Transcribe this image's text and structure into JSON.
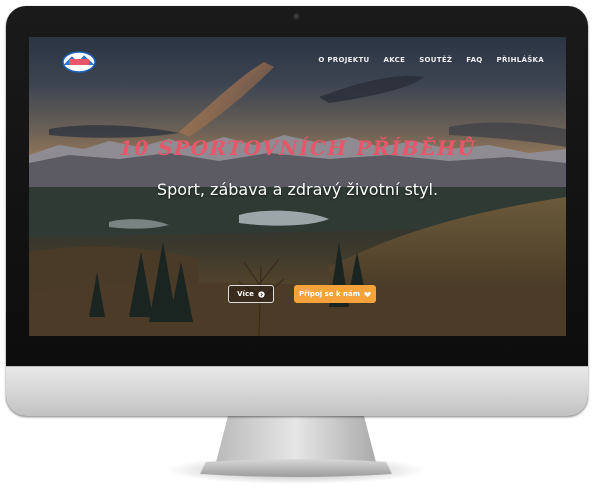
{
  "nav": {
    "items": [
      {
        "label": "O PROJEKTU"
      },
      {
        "label": "AKCE"
      },
      {
        "label": "SOUTĚŽ"
      },
      {
        "label": "FAQ"
      },
      {
        "label": "PŘIHLÁŠKA"
      }
    ]
  },
  "hero": {
    "title": "10 SPORTOVNÍCH PŘÍBĚHŮ",
    "subtitle": "Sport, zábava a zdravý životní styl."
  },
  "buttons": {
    "more_label": "Více",
    "join_label": "Připoj se k nám"
  },
  "colors": {
    "accent": "#f5a23a",
    "title": "#e8566a"
  },
  "icons": {
    "logo": "logo-badge",
    "more": "circle-arrow-icon",
    "join": "heart-icon"
  }
}
